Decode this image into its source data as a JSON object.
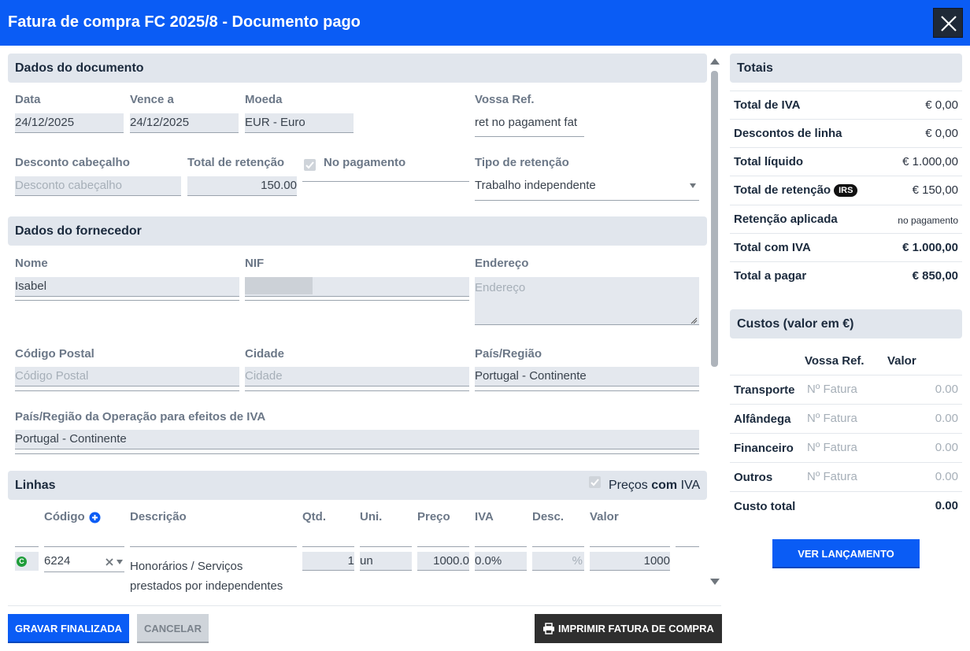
{
  "window": {
    "title": "Fatura de compra FC 2025/8 - Documento pago",
    "close_icon": "close-icon"
  },
  "doc": {
    "section_title": "Dados do documento",
    "date_label": "Data",
    "date_value": "24/12/2025",
    "due_label": "Vence a",
    "due_value": "24/12/2025",
    "currency_label": "Moeda",
    "currency_value": "EUR - Euro",
    "ref_label": "Vossa Ref.",
    "ref_value": "ret no pagament fat",
    "discount_label": "Desconto cabeçalho",
    "discount_placeholder": "Desconto cabeçalho",
    "retention_label": "Total de retenção",
    "retention_value": "150.00",
    "on_payment_label": "No pagamento",
    "retention_type_label": "Tipo de retenção",
    "retention_type_value": "Trabalho independente"
  },
  "supplier": {
    "section_title": "Dados do fornecedor",
    "name_label": "Nome",
    "name_value": "Isabel",
    "nif_label": "NIF",
    "address_label": "Endereço",
    "address_placeholder": "Endereço",
    "postal_label": "Código Postal",
    "postal_placeholder": "Código Postal",
    "city_label": "Cidade",
    "city_placeholder": "Cidade",
    "country_label": "País/Região",
    "country_value": "Portugal - Continente",
    "vat_country_label": "País/Região da Operação para efeitos de IVA",
    "vat_country_value": "Portugal - Continente"
  },
  "lines": {
    "section_title": "Linhas",
    "prices_prefix": "Preços ",
    "prices_bold": "com",
    "prices_suffix": " IVA",
    "headers": {
      "code": "Código",
      "desc": "Descrição",
      "qty": "Qtd.",
      "unit": "Uni.",
      "price": "Preço",
      "vat": "IVA",
      "disc": "Desc.",
      "value": "Valor"
    },
    "row": {
      "badge": "C",
      "code": "6224",
      "desc_line1": "Honorários / Serviços",
      "desc_line2": "prestados por independentes",
      "qty": "1",
      "unit": "un",
      "price": "1000.0",
      "vat": "0.0%",
      "disc_suffix": "%",
      "value": "1000"
    }
  },
  "totals": {
    "section_title": "Totais",
    "rows": [
      {
        "label": "Total de IVA",
        "value": "€ 0,00"
      },
      {
        "label": "Descontos de linha",
        "value": "€ 0,00"
      },
      {
        "label": "Total líquido",
        "value": "€ 1.000,00"
      },
      {
        "label": "Total de retenção",
        "badge": "IRS",
        "value": "€ 150,00"
      },
      {
        "label": "Retenção aplicada",
        "value": "no pagamento"
      },
      {
        "label": "Total com IVA",
        "value": "€ 1.000,00"
      },
      {
        "label": "Total a pagar",
        "value": "€ 850,00"
      }
    ]
  },
  "costs": {
    "section_title": "Custos (valor em €)",
    "col_ref": "Vossa Ref.",
    "col_value": "Valor",
    "rows": [
      {
        "label": "Transporte",
        "ref_placeholder": "Nº Fatura",
        "value": "0.00"
      },
      {
        "label": "Alfândega",
        "ref_placeholder": "Nº Fatura",
        "value": "0.00"
      },
      {
        "label": "Financeiro",
        "ref_placeholder": "Nº Fatura",
        "value": "0.00"
      },
      {
        "label": "Outros",
        "ref_placeholder": "Nº Fatura",
        "value": "0.00"
      }
    ],
    "total_label": "Custo total",
    "total_value": "0.00",
    "view_button": "VER LANÇAMENTO"
  },
  "footer": {
    "save_button": "GRAVAR FINALIZADA",
    "cancel_button": "CANCELAR",
    "print_button": "IMPRIMIR FATURA DE COMPRA"
  },
  "colors": {
    "accent": "#0a5cf5",
    "section_bg": "#e1e6ed",
    "field_bg": "#e4e8ee",
    "dark_button": "#2f2f2f",
    "badge_green": "#1f9d3a"
  }
}
